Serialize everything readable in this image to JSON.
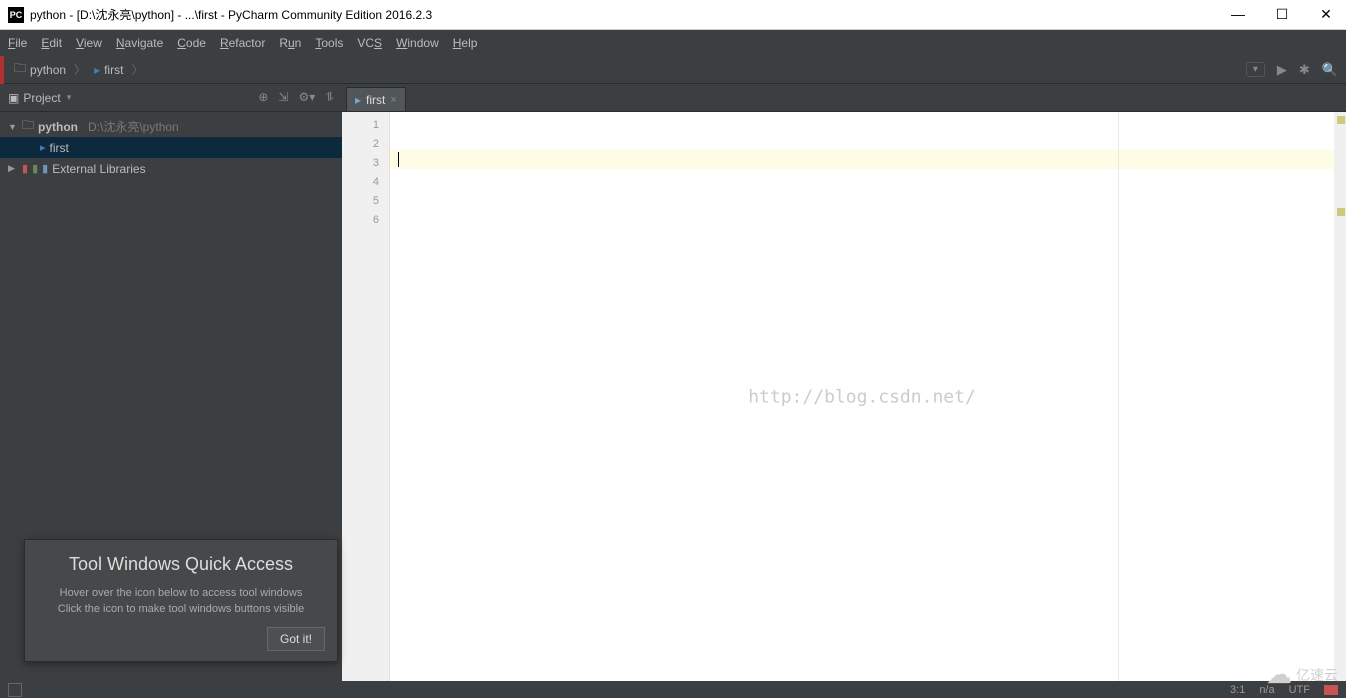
{
  "title": "python - [D:\\沈永亮\\python] - ...\\first - PyCharm Community Edition 2016.2.3",
  "menus": [
    "File",
    "Edit",
    "View",
    "Navigate",
    "Code",
    "Refactor",
    "Run",
    "Tools",
    "VCS",
    "Window",
    "Help"
  ],
  "breadcrumb": {
    "root": "python",
    "file": "first"
  },
  "project_tool": {
    "label": "Project"
  },
  "tree": {
    "root_name": "python",
    "root_path": "D:\\沈永亮\\python",
    "file": "first",
    "ext_lib": "External Libraries"
  },
  "tab": {
    "name": "first"
  },
  "gutter_lines": [
    "1",
    "2",
    "3",
    "4",
    "5",
    "6"
  ],
  "watermark": "http://blog.csdn.net/",
  "tooltip": {
    "title": "Tool Windows Quick Access",
    "l1": "Hover over the icon below to access tool windows",
    "l2": "Click the icon to make tool windows buttons visible",
    "btn": "Got it!"
  },
  "status": {
    "pos": "3:1",
    "sep": "n/a",
    "enc": "UTF"
  },
  "cloud": "亿速云"
}
